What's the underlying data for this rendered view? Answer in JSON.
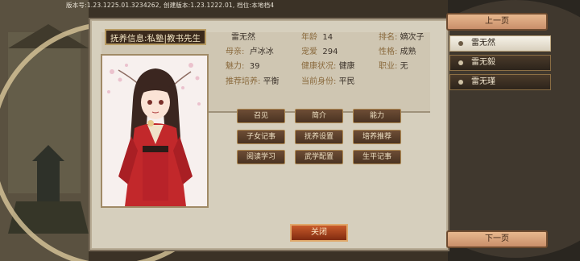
{
  "version_text": "版本号:1.23.1225.01.3234262, 创建版本:1.23.1222.01, 档位:本地档4",
  "panel": {
    "title": "抚养信息:私塾|教书先生",
    "name": "雷无然",
    "age_label": "年龄",
    "age": "14",
    "rank_label": "排名:",
    "rank": "嫡次子",
    "mother_label": "母亲:",
    "mother": "卢冰冰",
    "favor_label": "宠爱",
    "favor": "294",
    "personality_label": "性格:",
    "personality": "成熟",
    "charm_label": "魅力:",
    "charm": "39",
    "health_label": "健康状况:",
    "health": "健康",
    "job_label": "职业:",
    "job": "无",
    "recommend_label": "推荐培养:",
    "recommend": "平衡",
    "status_label": "当前身份:",
    "status": "平民"
  },
  "actions": [
    "召见",
    "简介",
    "能力",
    "子女记事",
    "抚养设置",
    "培养推荐",
    "阅读学习",
    "武学配置",
    "生平记事"
  ],
  "close_label": "关闭",
  "sidebar": {
    "prev": "上一页",
    "next": "下一页",
    "items": [
      "雷无然",
      "雷无毅",
      "雷无瑾"
    ]
  }
}
